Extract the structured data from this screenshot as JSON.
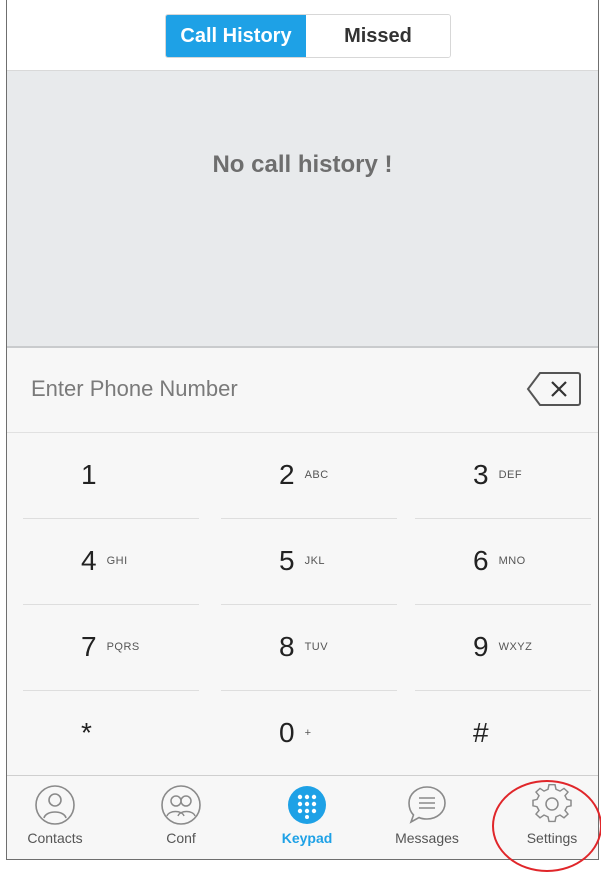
{
  "tabs": {
    "call_history": "Call History",
    "missed": "Missed"
  },
  "history": {
    "empty_message": "No call history !"
  },
  "phone_entry": {
    "placeholder": "Enter Phone Number"
  },
  "keypad": [
    {
      "num": "1",
      "letters": ""
    },
    {
      "num": "2",
      "letters": "ABC"
    },
    {
      "num": "3",
      "letters": "DEF"
    },
    {
      "num": "4",
      "letters": "GHI"
    },
    {
      "num": "5",
      "letters": "JKL"
    },
    {
      "num": "6",
      "letters": "MNO"
    },
    {
      "num": "7",
      "letters": "PQRS"
    },
    {
      "num": "8",
      "letters": "TUV"
    },
    {
      "num": "9",
      "letters": "WXYZ"
    },
    {
      "num": "*",
      "letters": ""
    },
    {
      "num": "0",
      "letters": "+"
    },
    {
      "num": "#",
      "letters": ""
    }
  ],
  "tabbar": [
    {
      "label": "Contacts",
      "icon": "contacts-icon"
    },
    {
      "label": "Conf",
      "icon": "conference-icon"
    },
    {
      "label": "Keypad",
      "icon": "keypad-icon",
      "active": true
    },
    {
      "label": "Messages",
      "icon": "messages-icon"
    },
    {
      "label": "Settings",
      "icon": "gear-icon"
    }
  ],
  "colors": {
    "accent": "#1ea1e6",
    "history_bg": "#e8eaec",
    "highlight": "#e0262a"
  }
}
